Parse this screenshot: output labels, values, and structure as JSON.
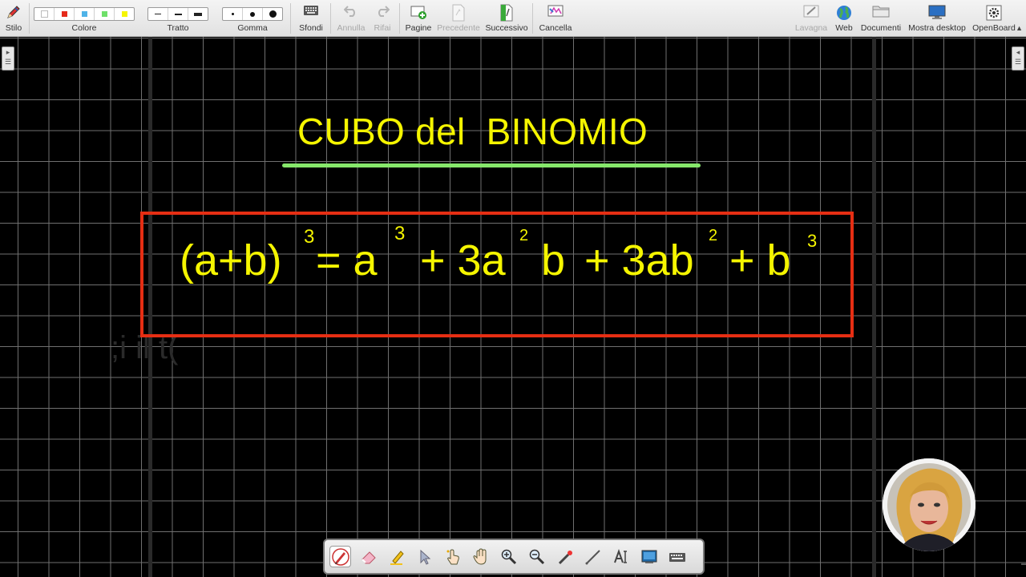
{
  "toolbar": {
    "stylus": {
      "label": "Stilo",
      "icon": "pen-icon"
    },
    "color": {
      "label": "Colore",
      "swatches": [
        "#ffffff",
        "#e52b1b",
        "#4fb3e8",
        "#6fe06a",
        "#f5f500"
      ]
    },
    "stroke": {
      "label": "Tratto"
    },
    "eraser": {
      "label": "Gomma"
    },
    "backgrounds": {
      "label": "Sfondi",
      "icon": "keyboard-icon"
    },
    "undo": {
      "label": "Annulla",
      "icon": "undo-icon"
    },
    "redo": {
      "label": "Rifai",
      "icon": "redo-icon"
    },
    "pages": {
      "label": "Pagine",
      "icon": "add-page-icon"
    },
    "previous": {
      "label": "Precedente",
      "icon": "previous-page-icon"
    },
    "next": {
      "label": "Successivo",
      "icon": "next-page-icon"
    },
    "clear": {
      "label": "Cancella",
      "icon": "clear-page-icon"
    },
    "board": {
      "label": "Lavagna",
      "icon": "board-icon"
    },
    "web": {
      "label": "Web",
      "icon": "globe-icon"
    },
    "documents": {
      "label": "Documenti",
      "icon": "folder-icon"
    },
    "desktop": {
      "label": "Mostra desktop",
      "icon": "monitor-icon"
    },
    "openboard": {
      "label": "OpenBoard",
      "icon": "openboard-gear-icon"
    }
  },
  "board": {
    "title": "CUBO del  BINOMIO",
    "formula": {
      "lhs": "(a+b)",
      "lhs_exp": "3",
      "eq_a": "= a",
      "a_exp": "3",
      "term2": "+ 3a",
      "term2_exp": "2",
      "term2_b": "b",
      "term3": "+ 3ab",
      "term3_exp": "2",
      "term4": "+ b",
      "term4_exp": "3"
    },
    "faint_text": ";i il t(",
    "colors": {
      "text": "#f5f500",
      "box": "#e62e13",
      "underline": "#86e86b"
    }
  },
  "bottom_toolbar": {
    "tools": [
      "pen-tool-icon",
      "eraser-tool-icon",
      "marker-tool-icon",
      "selector-tool-icon",
      "interact-tool-icon",
      "hand-tool-icon",
      "zoom-in-tool-icon",
      "zoom-out-tool-icon",
      "laser-pointer-tool-icon",
      "line-tool-icon",
      "text-tool-icon",
      "capture-tool-icon",
      "virtual-keyboard-icon"
    ]
  }
}
